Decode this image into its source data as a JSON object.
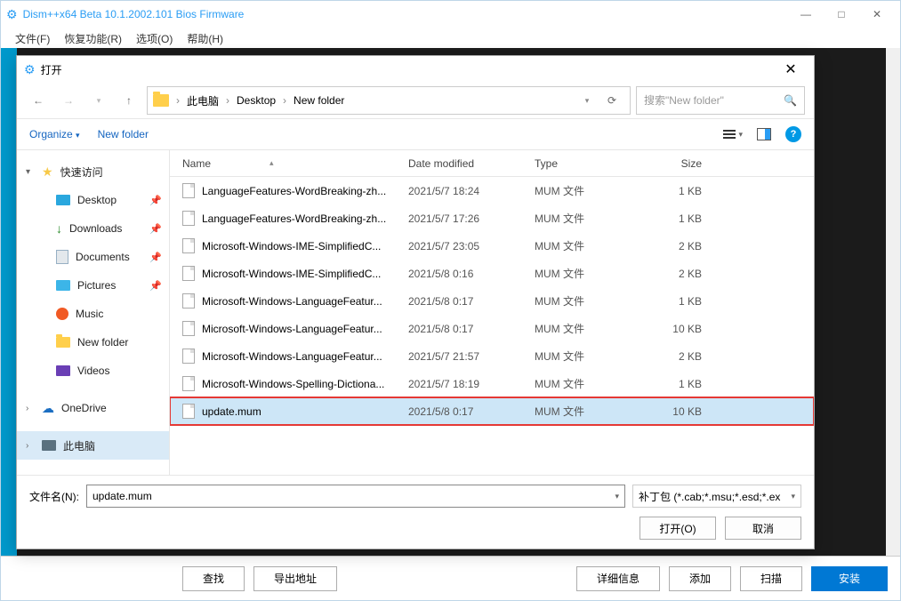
{
  "main": {
    "title": "Dism++x64 Beta 10.1.2002.101 Bios Firmware",
    "menu": {
      "file": "文件(F)",
      "restore": "恢复功能(R)",
      "options": "选项(O)",
      "help": "帮助(H)"
    },
    "bottom": {
      "find": "查找",
      "export": "导出地址",
      "details": "详细信息",
      "add": "添加",
      "scan": "扫描",
      "install": "安装"
    }
  },
  "dialog": {
    "title": "打开",
    "breadcrumb": {
      "pc": "此电脑",
      "desktop": "Desktop",
      "folder": "New folder"
    },
    "search_placeholder": "搜索\"New folder\"",
    "toolbar": {
      "organize": "Organize",
      "newfolder": "New folder"
    },
    "tree": {
      "quick": "快速访问",
      "desktop": "Desktop",
      "downloads": "Downloads",
      "documents": "Documents",
      "pictures": "Pictures",
      "music": "Music",
      "newfolder": "New folder",
      "videos": "Videos",
      "onedrive": "OneDrive",
      "thispc": "此电脑"
    },
    "columns": {
      "name": "Name",
      "date": "Date modified",
      "type": "Type",
      "size": "Size"
    },
    "files": [
      {
        "name": "LanguageFeatures-WordBreaking-zh...",
        "date": "2021/5/7 18:24",
        "type": "MUM 文件",
        "size": "1 KB"
      },
      {
        "name": "LanguageFeatures-WordBreaking-zh...",
        "date": "2021/5/7 17:26",
        "type": "MUM 文件",
        "size": "1 KB"
      },
      {
        "name": "Microsoft-Windows-IME-SimplifiedC...",
        "date": "2021/5/7 23:05",
        "type": "MUM 文件",
        "size": "2 KB"
      },
      {
        "name": "Microsoft-Windows-IME-SimplifiedC...",
        "date": "2021/5/8 0:16",
        "type": "MUM 文件",
        "size": "2 KB"
      },
      {
        "name": "Microsoft-Windows-LanguageFeatur...",
        "date": "2021/5/8 0:17",
        "type": "MUM 文件",
        "size": "1 KB"
      },
      {
        "name": "Microsoft-Windows-LanguageFeatur...",
        "date": "2021/5/8 0:17",
        "type": "MUM 文件",
        "size": "10 KB"
      },
      {
        "name": "Microsoft-Windows-LanguageFeatur...",
        "date": "2021/5/7 21:57",
        "type": "MUM 文件",
        "size": "2 KB"
      },
      {
        "name": "Microsoft-Windows-Spelling-Dictiona...",
        "date": "2021/5/7 18:19",
        "type": "MUM 文件",
        "size": "1 KB"
      },
      {
        "name": "update.mum",
        "date": "2021/5/8 0:17",
        "type": "MUM 文件",
        "size": "10 KB",
        "selected": true
      }
    ],
    "footer": {
      "filename_label": "文件名(N):",
      "filename_value": "update.mum",
      "filter": "补丁包 (*.cab;*.msu;*.esd;*.ex",
      "open": "打开(O)",
      "cancel": "取消"
    }
  }
}
